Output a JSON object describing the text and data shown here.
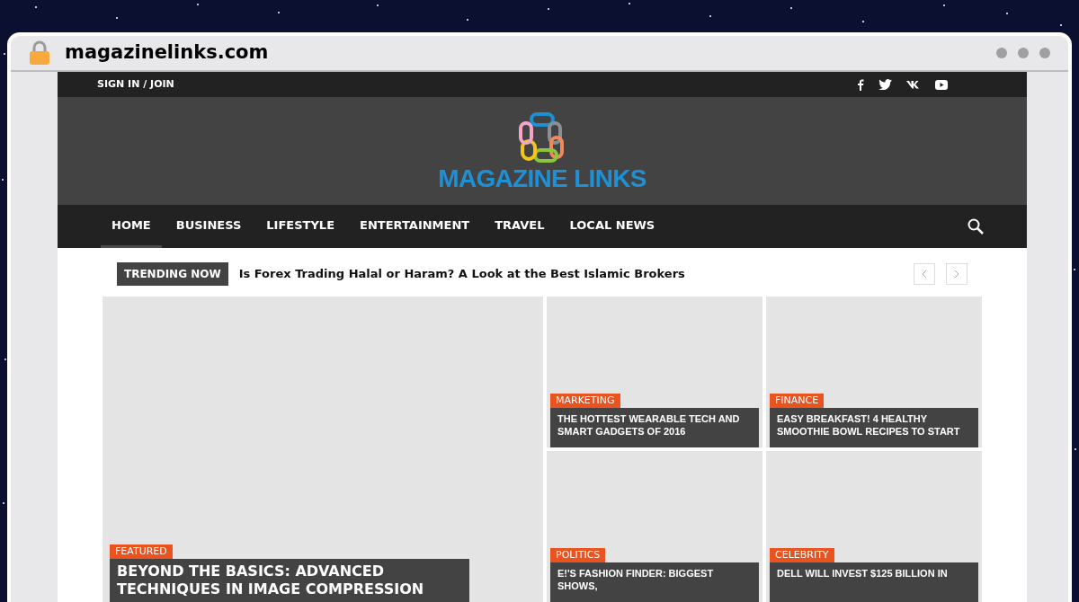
{
  "browser": {
    "address": "magazinelinks.com"
  },
  "top_bar": {
    "sign_in": "SIGN IN / JOIN"
  },
  "logo": {
    "text": "MAGAZINE LINKS"
  },
  "nav": [
    {
      "label": "HOME",
      "selected": true
    },
    {
      "label": "BUSINESS",
      "selected": false
    },
    {
      "label": "LIFESTYLE",
      "selected": false
    },
    {
      "label": "ENTERTAINMENT",
      "selected": false
    },
    {
      "label": "TRAVEL",
      "selected": false
    },
    {
      "label": "LOCAL NEWS",
      "selected": false
    }
  ],
  "trending": {
    "label": "TRENDING NOW",
    "headline": "Is Forex Trading Halal or Haram? A Look at the Best Islamic Brokers"
  },
  "featured": {
    "category": "FEATURED",
    "title": "BEYOND THE BASICS: ADVANCED TECHNIQUES IN IMAGE COMPRESSION"
  },
  "tiles": [
    {
      "category": "MARKETING",
      "title": "THE HOTTEST WEARABLE TECH AND SMART GADGETS OF 2016"
    },
    {
      "category": "FINANCE",
      "title": "EASY BREAKFAST! 4 HEALTHY SMOOTHIE BOWL RECIPES TO START"
    },
    {
      "category": "POLITICS",
      "title": "E!'S FASHION FINDER: BIGGEST SHOWS,"
    },
    {
      "category": "CELEBRITY",
      "title": "DELL WILL INVEST $125 BILLION IN"
    }
  ]
}
